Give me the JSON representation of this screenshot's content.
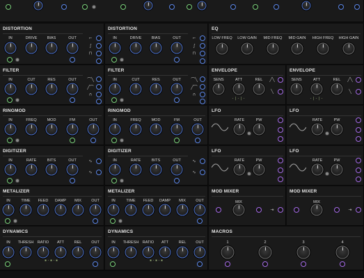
{
  "modules": {
    "dist1": {
      "title": "DISTORTION",
      "labels": [
        "IN",
        "DRIVE",
        "BIAS",
        "OUT"
      ]
    },
    "dist2": {
      "title": "DISTORTION",
      "labels": [
        "IN",
        "DRIVE",
        "BIAS",
        "OUT"
      ]
    },
    "eq": {
      "title": "EQ",
      "labels": [
        "LOW FREQ",
        "LOW GAIN",
        "MID FREQ",
        "MID GAIN",
        "HIGH FREQ",
        "HIGH GAIN"
      ]
    },
    "filt1": {
      "title": "FILTER",
      "labels": [
        "IN",
        "CUT",
        "RES",
        "OUT"
      ]
    },
    "filt2": {
      "title": "FILTER",
      "labels": [
        "IN",
        "CUT",
        "RES",
        "OUT"
      ]
    },
    "env1": {
      "title": "ENVELOPE",
      "labels": [
        "SENS",
        "ATT",
        "REL"
      ]
    },
    "env2": {
      "title": "ENVELOPE",
      "labels": [
        "SENS",
        "ATT",
        "REL"
      ]
    },
    "ring1": {
      "title": "RINGMOD",
      "labels": [
        "IN",
        "FREQ",
        "MOD",
        "FM",
        "OUT"
      ]
    },
    "ring2": {
      "title": "RINGMOD",
      "labels": [
        "IN",
        "FREQ",
        "MOD",
        "FM",
        "OUT"
      ]
    },
    "lfo1": {
      "title": "LFO",
      "labels": [
        "RATE",
        "PW"
      ]
    },
    "lfo2": {
      "title": "LFO",
      "labels": [
        "RATE",
        "PW"
      ]
    },
    "dig1": {
      "title": "DIGITIZER",
      "labels": [
        "IN",
        "RATE",
        "BITS",
        "OUT"
      ]
    },
    "dig2": {
      "title": "DIGITIZER",
      "labels": [
        "IN",
        "RATE",
        "BITS",
        "OUT"
      ]
    },
    "lfo3": {
      "title": "LFO",
      "labels": [
        "RATE",
        "PW"
      ]
    },
    "lfo4": {
      "title": "LFO",
      "labels": [
        "RATE",
        "PW"
      ]
    },
    "met1": {
      "title": "METALIZER",
      "labels": [
        "IN",
        "TIME",
        "FEED",
        "DAMP",
        "MIX",
        "OUT"
      ]
    },
    "met2": {
      "title": "METALIZER",
      "labels": [
        "IN",
        "TIME",
        "FEED",
        "DAMP",
        "MIX",
        "OUT"
      ]
    },
    "mm1": {
      "title": "MOD MIXER",
      "labels": [
        "MIX"
      ]
    },
    "mm2": {
      "title": "MOD MIXER",
      "labels": [
        "MIX"
      ]
    },
    "dyn1": {
      "title": "DYNAMICS",
      "labels": [
        "IN",
        "THRESH",
        "RATIO",
        "ATT",
        "REL",
        "OUT"
      ]
    },
    "dyn2": {
      "title": "DYNAMICS",
      "labels": [
        "IN",
        "THRESH",
        "RATIO",
        "ATT",
        "REL",
        "OUT"
      ]
    },
    "macros": {
      "title": "MACROS",
      "labels": [
        "1",
        "2",
        "3",
        "4"
      ]
    }
  },
  "colors": {
    "accent_blue": "#5b86e8",
    "accent_green": "#7ad17a",
    "accent_purple": "#a56be8",
    "panel": "#1a1a1a"
  }
}
